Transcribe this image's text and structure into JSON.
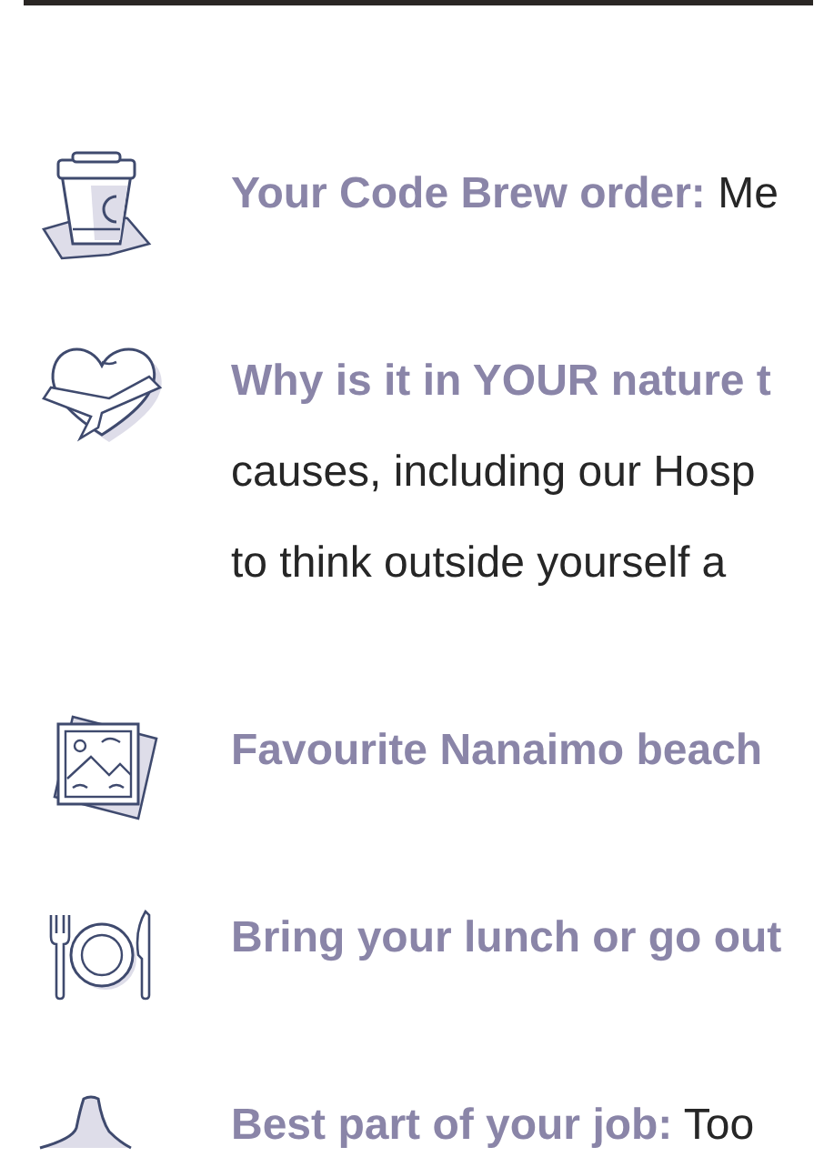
{
  "items": [
    {
      "kind": "cup",
      "question": "Your Code Brew order:",
      "answer": "Me"
    },
    {
      "kind": "heart",
      "question": "Why is it in YOUR nature t",
      "more_lines": [
        "causes, including our Hosp",
        "to think outside yourself a"
      ]
    },
    {
      "kind": "photo",
      "question": "Favourite Nanaimo beach"
    },
    {
      "kind": "plate",
      "question": "Bring your lunch or go out"
    },
    {
      "kind": "thumb",
      "question": "Best part of your job:",
      "answer": "Too"
    }
  ]
}
